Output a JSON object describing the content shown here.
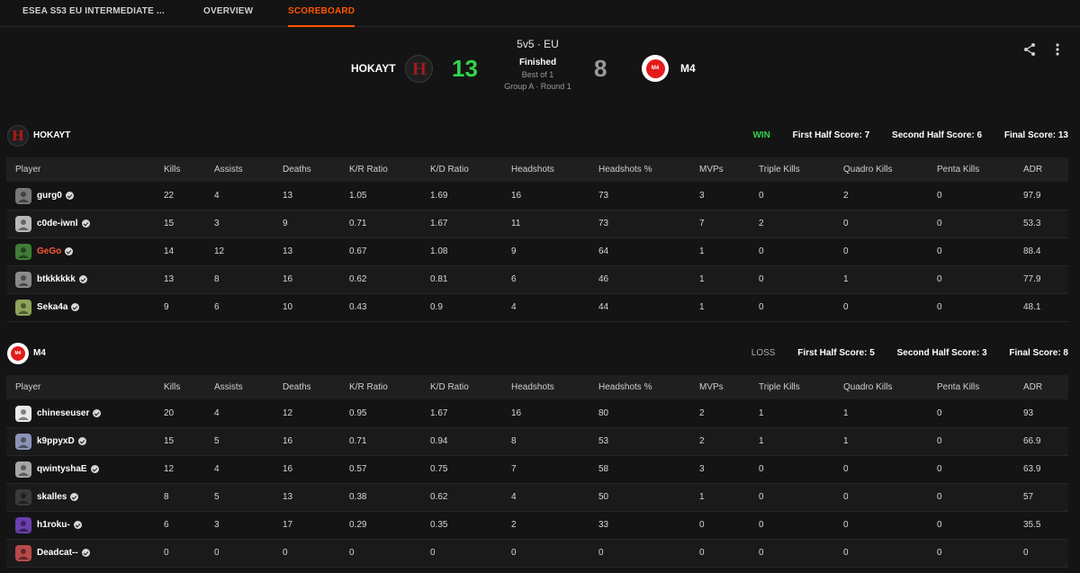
{
  "nav": {
    "tabs": [
      {
        "label": "ESEA S53 EU INTERMEDIATE ...",
        "active": false
      },
      {
        "label": "OVERVIEW",
        "active": false
      },
      {
        "label": "SCOREBOARD",
        "active": true
      }
    ]
  },
  "match": {
    "mode": "5v5 · EU",
    "status": "Finished",
    "best_of": "Best of 1",
    "group": "Group A · Round 1",
    "team1": {
      "name": "HOKAYT",
      "score": "13",
      "logo_icon": "hokayt-logo-icon"
    },
    "team2": {
      "name": "M4",
      "score": "8",
      "logo_icon": "m4-logo-icon",
      "logo_text": "M4"
    }
  },
  "columns": [
    "Player",
    "Kills",
    "Assists",
    "Deaths",
    "K/R Ratio",
    "K/D Ratio",
    "Headshots",
    "Headshots %",
    "MVPs",
    "Triple Kills",
    "Quadro Kills",
    "Penta Kills",
    "ADR"
  ],
  "teams": [
    {
      "name": "HOKAYT",
      "result": "WIN",
      "first_half": "First Half Score: 7",
      "second_half": "Second Half Score: 6",
      "final": "Final Score: 13",
      "players": [
        {
          "name": "gurg0",
          "avatar": "#777777",
          "highlight": false,
          "stats": [
            "22",
            "4",
            "13",
            "1.05",
            "1.69",
            "16",
            "73",
            "3",
            "0",
            "2",
            "0",
            "97.9"
          ]
        },
        {
          "name": "c0de-iwnl",
          "avatar": "#b9b9b9",
          "highlight": false,
          "stats": [
            "15",
            "3",
            "9",
            "0.71",
            "1.67",
            "11",
            "73",
            "7",
            "2",
            "0",
            "0",
            "53.3"
          ]
        },
        {
          "name": "GeGo",
          "avatar": "#3f7d37",
          "highlight": true,
          "stats": [
            "14",
            "12",
            "13",
            "0.67",
            "1.08",
            "9",
            "64",
            "1",
            "0",
            "0",
            "0",
            "88.4"
          ]
        },
        {
          "name": "btkkkkkk",
          "avatar": "#8a8a8a",
          "highlight": false,
          "stats": [
            "13",
            "8",
            "16",
            "0.62",
            "0.81",
            "6",
            "46",
            "1",
            "0",
            "1",
            "0",
            "77.9"
          ]
        },
        {
          "name": "Seka4a",
          "avatar": "#8fa35a",
          "highlight": false,
          "stats": [
            "9",
            "6",
            "10",
            "0.43",
            "0.9",
            "4",
            "44",
            "1",
            "0",
            "0",
            "0",
            "48.1"
          ]
        }
      ]
    },
    {
      "name": "M4",
      "result": "LOSS",
      "first_half": "First Half Score: 5",
      "second_half": "Second Half Score: 3",
      "final": "Final Score: 8",
      "players": [
        {
          "name": "chineseuser",
          "avatar": "#e8e8e8",
          "highlight": false,
          "stats": [
            "20",
            "4",
            "12",
            "0.95",
            "1.67",
            "16",
            "80",
            "2",
            "1",
            "1",
            "0",
            "93"
          ]
        },
        {
          "name": "k9ppyxD",
          "avatar": "#8c93b8",
          "highlight": false,
          "stats": [
            "15",
            "5",
            "16",
            "0.71",
            "0.94",
            "8",
            "53",
            "2",
            "1",
            "1",
            "0",
            "66.9"
          ]
        },
        {
          "name": "qwintyshaE",
          "avatar": "#a6a6a6",
          "highlight": false,
          "stats": [
            "12",
            "4",
            "16",
            "0.57",
            "0.75",
            "7",
            "58",
            "3",
            "0",
            "0",
            "0",
            "63.9"
          ]
        },
        {
          "name": "skalles",
          "avatar": "#3a3a3a",
          "highlight": false,
          "stats": [
            "8",
            "5",
            "13",
            "0.38",
            "0.62",
            "4",
            "50",
            "1",
            "0",
            "0",
            "0",
            "57"
          ]
        },
        {
          "name": "h1roku-",
          "avatar": "#6b3fb0",
          "highlight": false,
          "stats": [
            "6",
            "3",
            "17",
            "0.29",
            "0.35",
            "2",
            "33",
            "0",
            "0",
            "0",
            "0",
            "35.5"
          ]
        },
        {
          "name": "Deadcat--",
          "avatar": "#b84a4a",
          "highlight": false,
          "stats": [
            "0",
            "0",
            "0",
            "0",
            "0",
            "0",
            "0",
            "0",
            "0",
            "0",
            "0",
            "0"
          ]
        }
      ]
    }
  ],
  "icons": {
    "share": "share-icon",
    "more": "more-vertical-icon",
    "verified": "verified-icon"
  },
  "colors": {
    "accent": "#ff5500",
    "win": "#32d44c",
    "loss": "#9a9a9a"
  }
}
